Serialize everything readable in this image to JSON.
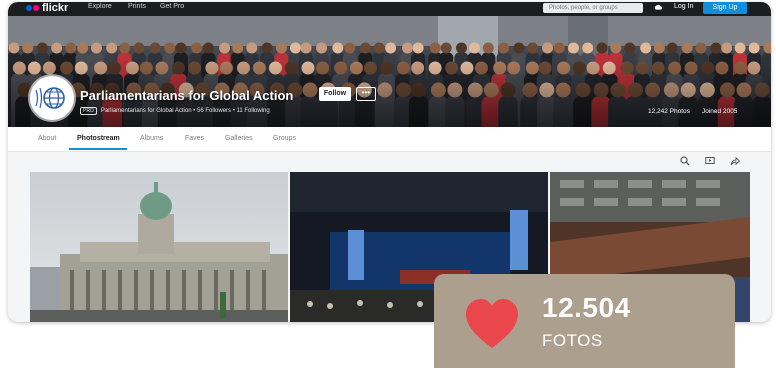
{
  "nav": {
    "logo": "flickr",
    "links": [
      "Explore",
      "Prints",
      "Get Pro"
    ],
    "search_placeholder": "Photos, people, or groups",
    "login": "Log In",
    "signup": "Sign Up"
  },
  "profile": {
    "name": "Parliamentarians for Global Action",
    "pro_badge": "PRO",
    "username": "Parliamentarians for Global Action",
    "followers": "56 Followers",
    "following": "11 Following",
    "follow_label": "Follow",
    "more_label": "•••",
    "photos_stat": "12,242 Photos",
    "joined_stat": "Joined 2005"
  },
  "tabs": [
    {
      "label": "About"
    },
    {
      "label": "Photostream"
    },
    {
      "label": "Albums"
    },
    {
      "label": "Faves"
    },
    {
      "label": "Galleries"
    },
    {
      "label": "Groups"
    }
  ],
  "toolbar_icons": [
    "search-icon",
    "slideshow-icon",
    "share-icon"
  ],
  "overlay": {
    "count": "12.504",
    "label": "FOTOS",
    "icon": "heart-icon",
    "icon_color": "#e9474c",
    "background": "#ac9f8e"
  },
  "colors": {
    "accent": "#128fdc",
    "nav_bg": "#1b1d1f"
  }
}
